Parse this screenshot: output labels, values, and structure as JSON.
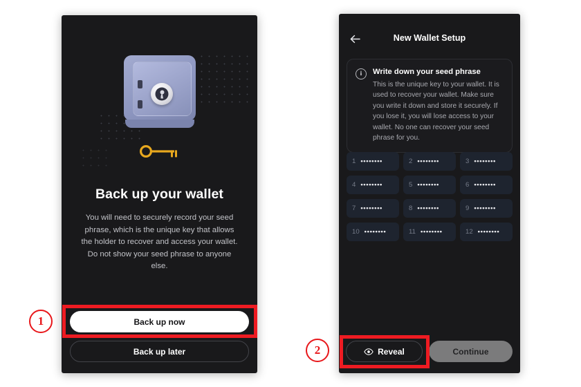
{
  "colors": {
    "panel_bg": "#19191b",
    "highlight_red": "#ee1b22",
    "seed_cell_bg": "#1e242f",
    "safe_blue": "#99a1c8",
    "key_gold": "#e8a81e",
    "continue_grey": "#7b7b7c"
  },
  "left_screen": {
    "illustration": {
      "safe_icon": "safe-vault-icon",
      "key_icon": "key-icon",
      "dot_pattern": "dot-grid-pattern"
    },
    "title": "Back up your wallet",
    "body": "You will need to securely record your seed phrase, which is the unique key that allows the holder to recover and access your wallet. Do not show your seed phrase to anyone else.",
    "primary_button": "Back up now",
    "secondary_button": "Back up later"
  },
  "right_screen": {
    "back_icon": "back-arrow-icon",
    "title": "New Wallet Setup",
    "info": {
      "icon": "info-circle-icon",
      "title": "Write down your seed phrase",
      "body": "This is the unique key to your wallet. It is used to recover your wallet. Make sure you write it down and store it securely. If you lose it, you will lose access to your wallet. No one can recover your seed phrase for you."
    },
    "seed_words": [
      {
        "num": "1",
        "masked": "••••••••"
      },
      {
        "num": "2",
        "masked": "••••••••"
      },
      {
        "num": "3",
        "masked": "••••••••"
      },
      {
        "num": "4",
        "masked": "••••••••"
      },
      {
        "num": "5",
        "masked": "••••••••"
      },
      {
        "num": "6",
        "masked": "••••••••"
      },
      {
        "num": "7",
        "masked": "••••••••"
      },
      {
        "num": "8",
        "masked": "••••••••"
      },
      {
        "num": "9",
        "masked": "••••••••"
      },
      {
        "num": "10",
        "masked": "••••••••"
      },
      {
        "num": "11",
        "masked": "••••••••"
      },
      {
        "num": "12",
        "masked": "••••••••"
      }
    ],
    "reveal_button": "Reveal",
    "reveal_icon": "eye-icon",
    "continue_button": "Continue"
  },
  "annotations": {
    "step_1": "1",
    "step_2": "2"
  }
}
